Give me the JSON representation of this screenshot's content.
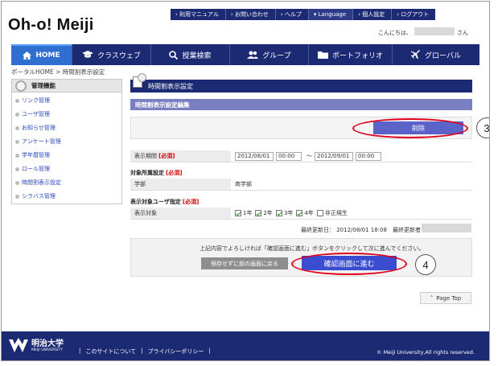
{
  "util_links": [
    "› 利用マニュアル",
    "› お問い合わせ",
    "› ヘルプ",
    "▾ Language",
    "› 個人設定",
    "› ログアウト"
  ],
  "logo": "Oh-o! Meiji",
  "greeting": {
    "prefix": "こんにちは、",
    "suffix": "さん"
  },
  "nav": [
    {
      "label": "HOME",
      "icon": "home-icon"
    },
    {
      "label": "クラスウェブ",
      "icon": "graduation-cap-icon"
    },
    {
      "label": "授業検索",
      "icon": "search-icon"
    },
    {
      "label": "グループ",
      "icon": "group-icon"
    },
    {
      "label": "ポートフォリオ",
      "icon": "folder-icon"
    },
    {
      "label": "グローバル",
      "icon": "airplane-icon"
    }
  ],
  "breadcrumb": "ポータルHOME > 時間割表示設定",
  "sidebar": {
    "title": "管理機能",
    "items": [
      "リンク管理",
      "ユーザ管理",
      "お知らせ管理",
      "アンケート管理",
      "学年暦管理",
      "ロール管理",
      "時間割表示設定",
      "シラバス管理"
    ]
  },
  "content": {
    "title": "時間割表示設定",
    "subtitle": "時間割表示設定編集",
    "delete_label": "削除",
    "annotation_3": "3",
    "annotation_4": "4",
    "period": {
      "label": "表示期間",
      "required": "[必須]",
      "start_date": "2012/08/01",
      "start_time": "00:00",
      "sep": "～",
      "end_date": "2012/09/01",
      "end_time": "00:00"
    },
    "org": {
      "section": "対象所属設定",
      "required": "[必須]",
      "label": "学部",
      "value": "商学部"
    },
    "target": {
      "section": "表示対象ユーザ指定",
      "required": "[必須]",
      "label": "表示対象",
      "options": [
        {
          "label": "1年",
          "checked": true
        },
        {
          "label": "2年",
          "checked": true
        },
        {
          "label": "3年",
          "checked": true
        },
        {
          "label": "4年",
          "checked": true
        },
        {
          "label": "非正規生",
          "checked": false
        }
      ]
    },
    "last_updated": "最終更新日： 2012/08/01 18:08　最終更新者：",
    "confirm_text": "上記内容でよろしければ「確認画面に進む」ボタンをクリックして次に進んでください。",
    "back_label": "保存せずに前の画面に戻る",
    "next_label": "確認画面に進む",
    "page_top": "Page Top"
  },
  "footer": {
    "univ": "明治大学",
    "univ_en": "MEIJI UNIVERSITY",
    "links": [
      "|",
      "このサイトについて",
      "|",
      "プライバシーポリシー",
      "|"
    ],
    "copyright": "© Meiji University,All rights reserved."
  },
  "colors": {
    "navy": "#1c2a74",
    "home_blue": "#2f6fd0",
    "accent": "#5b63c9",
    "highlight_ring": "#e0001a"
  }
}
